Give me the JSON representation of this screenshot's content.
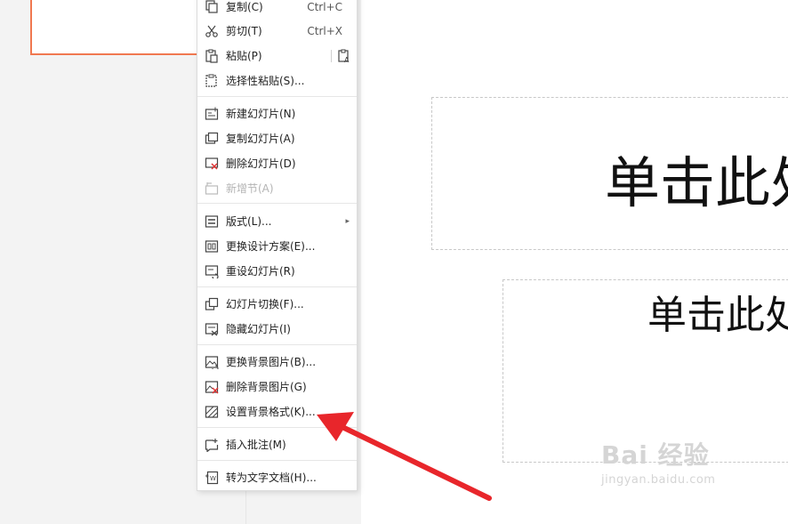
{
  "slide": {
    "title_placeholder": "单击此处",
    "subtitle_placeholder": "单击此处"
  },
  "watermark": {
    "brand": "Bai 经验",
    "url": "jingyan.baidu.com"
  },
  "context_menu": {
    "items": [
      {
        "label": "复制(C)",
        "shortcut": "Ctrl+C",
        "icon": "copy-icon"
      },
      {
        "label": "剪切(T)",
        "shortcut": "Ctrl+X",
        "icon": "scissors-icon"
      },
      {
        "label": "粘贴(P)",
        "icon": "paste-icon"
      },
      {
        "label": "选择性粘贴(S)...",
        "icon": "paste-special-icon"
      },
      {
        "label": "新建幻灯片(N)",
        "icon": "new-slide-icon"
      },
      {
        "label": "复制幻灯片(A)",
        "icon": "duplicate-slide-icon"
      },
      {
        "label": "删除幻灯片(D)",
        "icon": "delete-slide-icon"
      },
      {
        "label": "新增节(A)",
        "icon": "new-section-icon",
        "disabled": true
      },
      {
        "label": "版式(L)...",
        "icon": "layout-icon",
        "submenu": true
      },
      {
        "label": "更换设计方案(E)...",
        "icon": "design-icon"
      },
      {
        "label": "重设幻灯片(R)",
        "icon": "reset-slide-icon"
      },
      {
        "label": "幻灯片切换(F)...",
        "icon": "transition-icon"
      },
      {
        "label": "隐藏幻灯片(I)",
        "icon": "hide-slide-icon"
      },
      {
        "label": "更换背景图片(B)...",
        "icon": "change-background-icon"
      },
      {
        "label": "删除背景图片(G)",
        "icon": "delete-background-icon"
      },
      {
        "label": "设置背景格式(K)...",
        "icon": "background-format-icon"
      },
      {
        "label": "插入批注(M)",
        "icon": "comment-icon"
      },
      {
        "label": "转为文字文档(H)...",
        "icon": "convert-doc-icon"
      }
    ]
  },
  "colors": {
    "thumbnail_border": "#f07850",
    "annotation_arrow": "#e8262b",
    "delete_icon_accent": "#e03030"
  }
}
